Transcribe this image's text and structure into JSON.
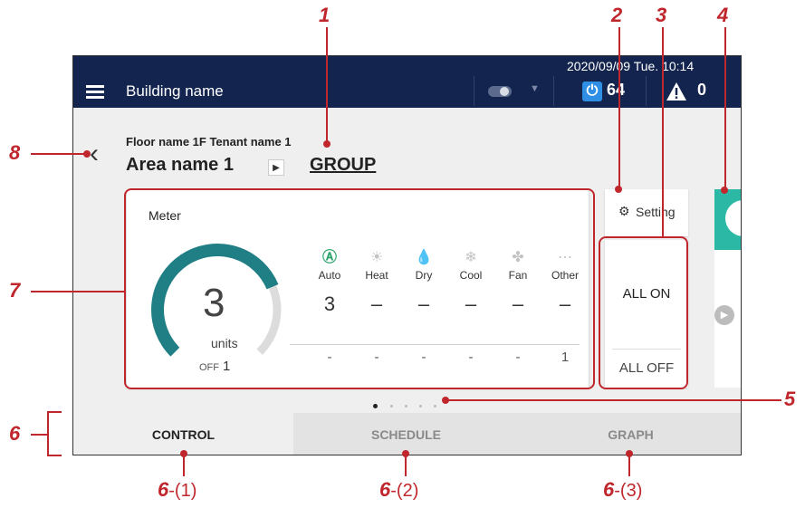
{
  "topbar": {
    "building_name": "Building name",
    "datetime": "2020/09/09 Tue. 10:14",
    "power_count": "64",
    "alert_count": "0",
    "color": "#13254f"
  },
  "header": {
    "floor_label": "Floor name 1F Tenant name 1",
    "area_name": "Area name 1",
    "group_link": "GROUP"
  },
  "meter": {
    "title": "Meter",
    "count": "3",
    "unit": "units",
    "off_label": "OFF",
    "off_count": "1",
    "gauge_fill_fraction": 0.75,
    "accent_color": "#1f7f84",
    "modes": [
      {
        "label": "Auto",
        "icon": "auto-mode-icon",
        "on_value": "3",
        "off_value": "-"
      },
      {
        "label": "Heat",
        "icon": "sun-icon",
        "on_value": "–",
        "off_value": "-"
      },
      {
        "label": "Dry",
        "icon": "drop-icon",
        "on_value": "–",
        "off_value": "-"
      },
      {
        "label": "Cool",
        "icon": "snowflake-icon",
        "on_value": "–",
        "off_value": "-"
      },
      {
        "label": "Fan",
        "icon": "fan-icon",
        "on_value": "–",
        "off_value": "-"
      },
      {
        "label": "Other",
        "icon": "more-icon",
        "on_value": "–",
        "off_value": "1"
      }
    ]
  },
  "controls": {
    "setting_label": "Setting",
    "all_on": "ALL ON",
    "all_off": "ALL OFF"
  },
  "tabs": [
    {
      "label": "CONTROL",
      "active": true
    },
    {
      "label": "SCHEDULE",
      "active": false
    },
    {
      "label": "GRAPH",
      "active": false
    }
  ],
  "callouts": {
    "n1": "1",
    "n2": "2",
    "n3": "3",
    "n4": "4",
    "n5": "5",
    "n6": "6",
    "n7": "7",
    "n8": "8",
    "tab1_num": "6",
    "tab1_sub": "-(1)",
    "tab2_num": "6",
    "tab2_sub": "-(2)",
    "tab3_num": "6",
    "tab3_sub": "-(3)",
    "color": "#c0272d"
  }
}
